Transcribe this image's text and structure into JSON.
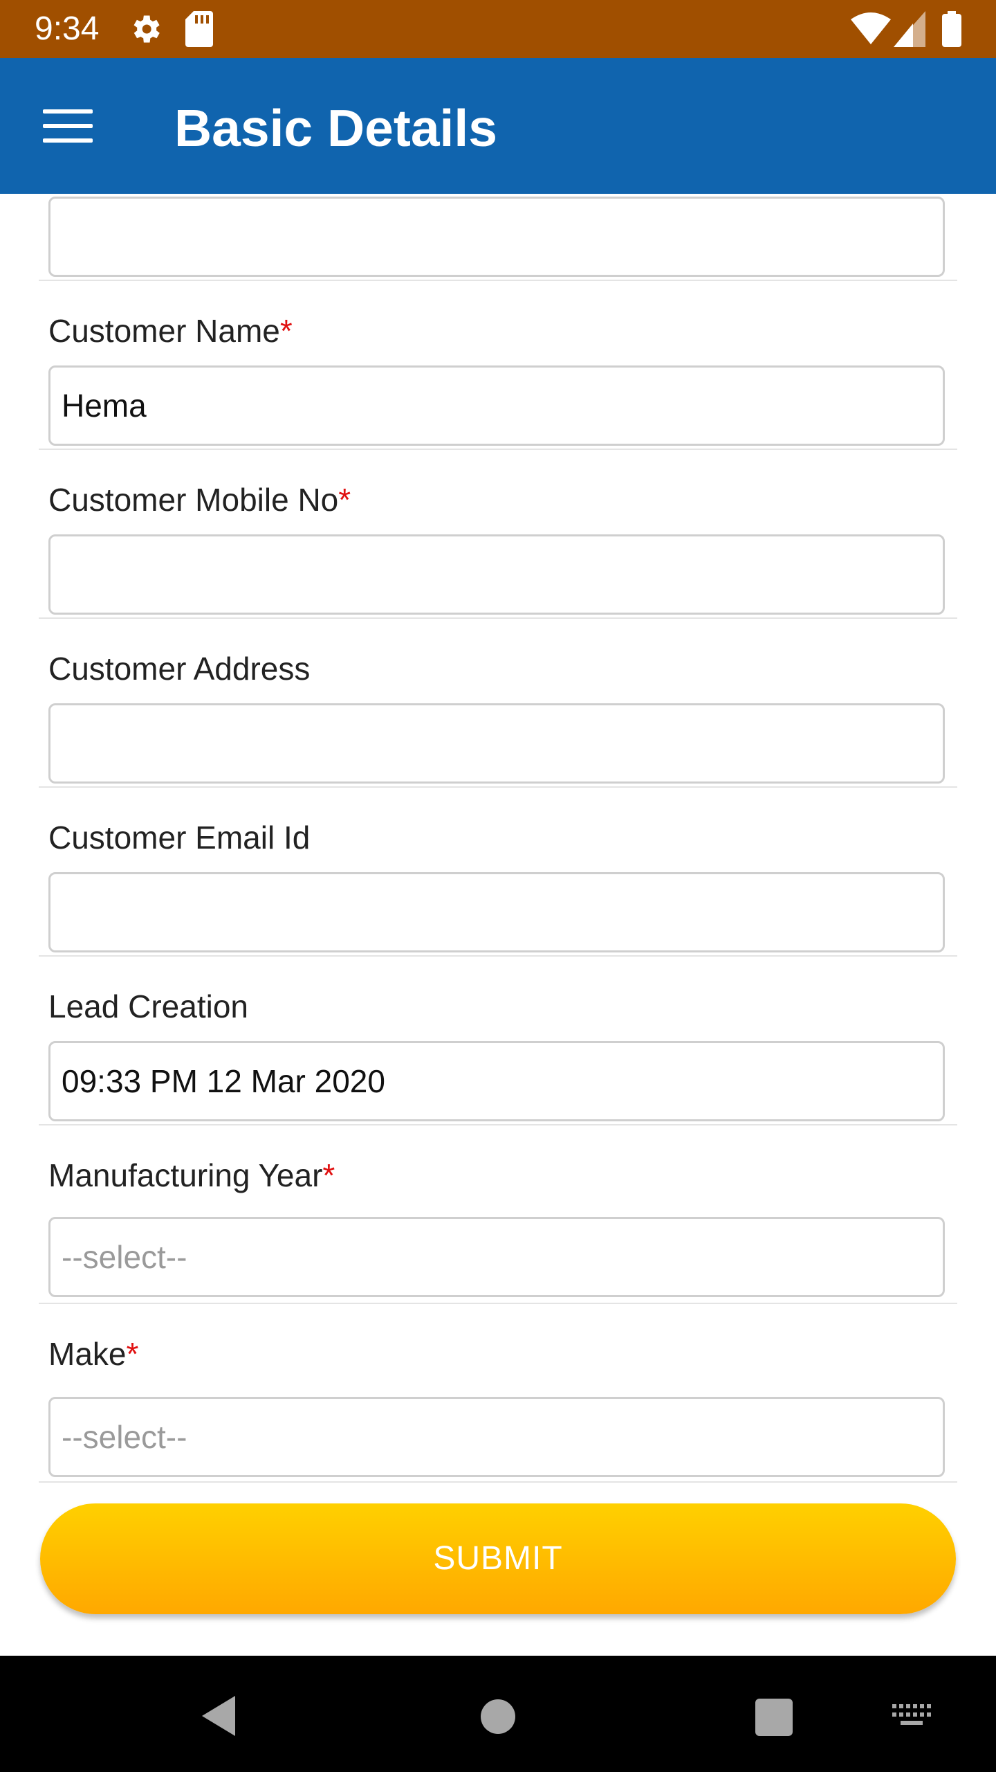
{
  "status_bar": {
    "time": "9:34",
    "icons": [
      "gear-icon",
      "sd-card-icon",
      "wifi-icon",
      "signal-icon",
      "battery-icon"
    ]
  },
  "app_bar": {
    "title": "Basic Details",
    "menu_icon": "hamburger-menu-icon"
  },
  "form": {
    "top_field_value": "",
    "fields": [
      {
        "label": "Customer Name",
        "required": "*",
        "value": "Hema"
      },
      {
        "label": "Customer Mobile No",
        "required": "*",
        "value": ""
      },
      {
        "label": "Customer Address",
        "value": ""
      },
      {
        "label": "Customer Email Id",
        "value": ""
      },
      {
        "label": "Lead Creation",
        "value": "09:33 PM 12 Mar 2020"
      },
      {
        "label": "Manufacturing Year",
        "required": "*",
        "placeholder": "--select--"
      },
      {
        "label": "Make",
        "required": "*",
        "placeholder": "--select--"
      }
    ],
    "submit_label": "SUBMIT"
  },
  "nav_bar": {
    "icons": [
      "back-icon",
      "home-icon",
      "recents-icon",
      "keyboard-icon"
    ]
  },
  "colors": {
    "status_bar": "#a04f00",
    "app_bar": "#1064ae",
    "required": "#e01010",
    "submit_top": "#ffd000",
    "submit_bottom": "#ffa800"
  }
}
